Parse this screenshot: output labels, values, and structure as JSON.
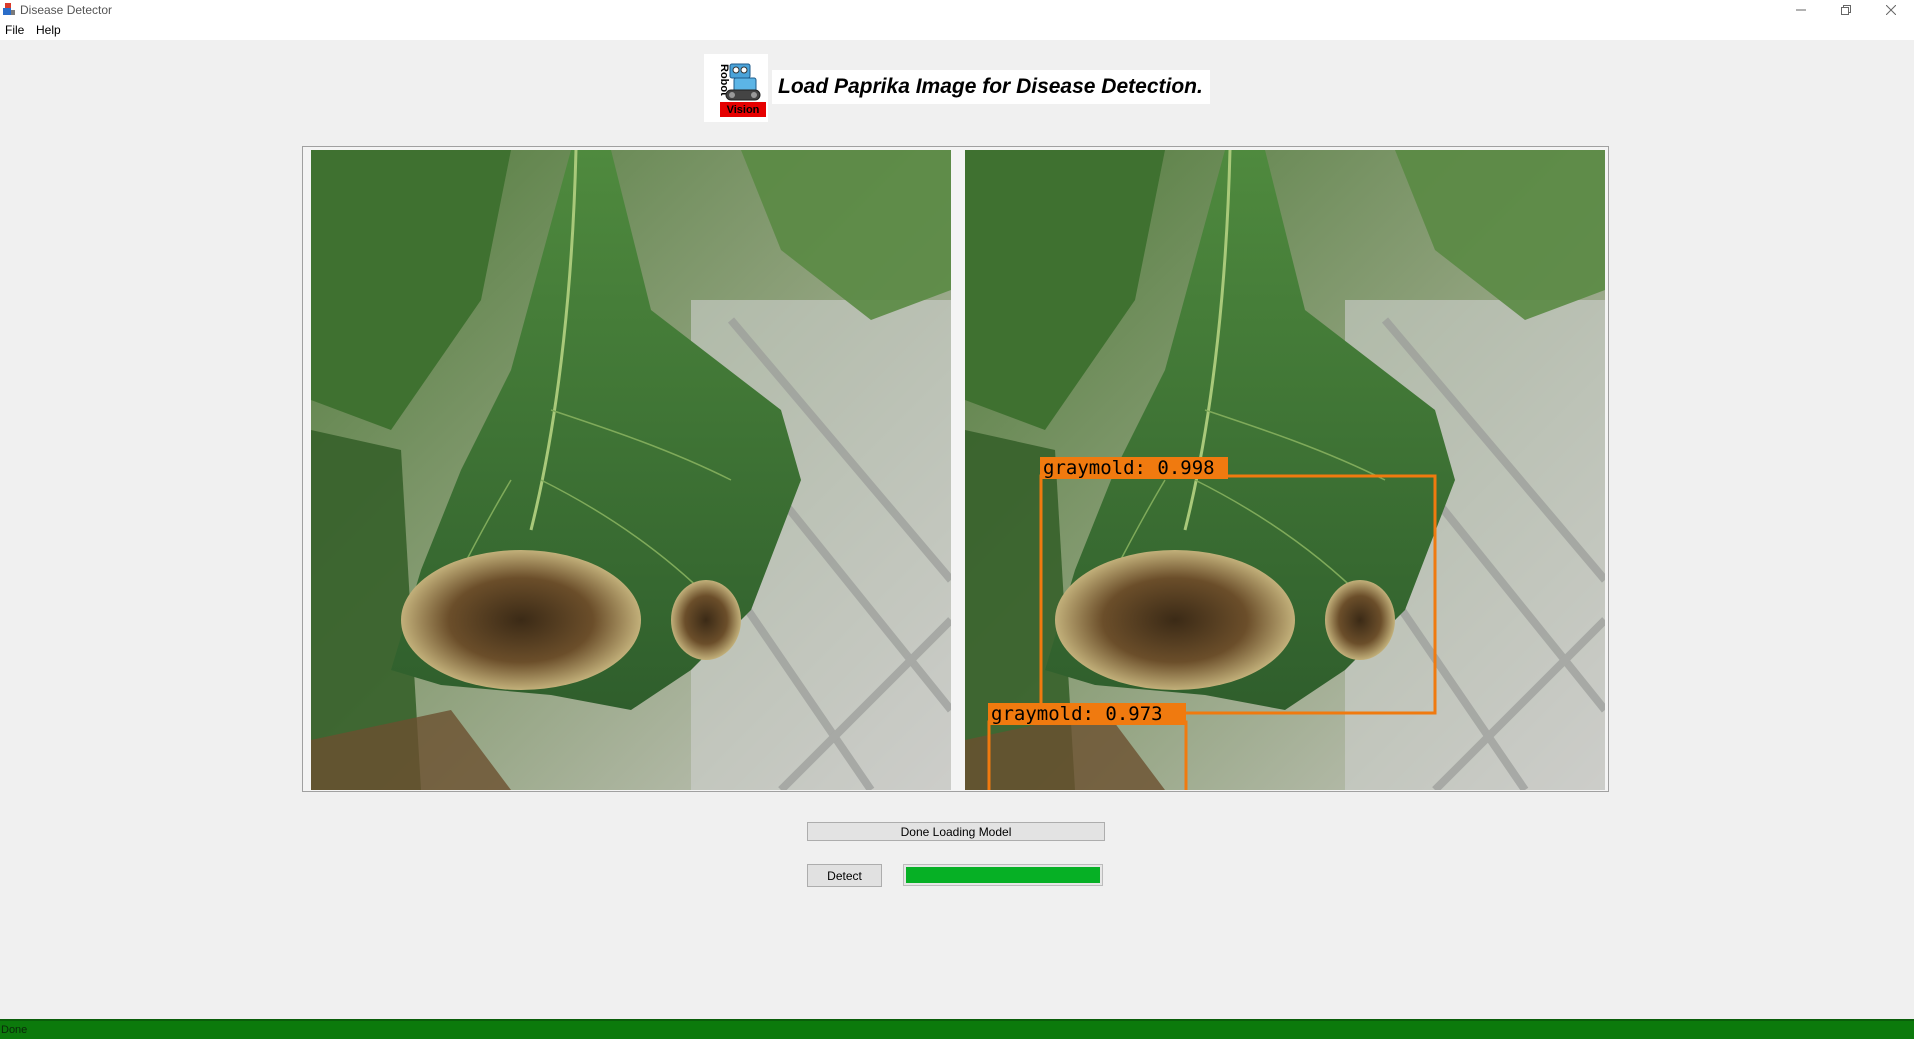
{
  "window": {
    "title": "Disease Detector"
  },
  "menu": {
    "items": [
      "File",
      "Help"
    ]
  },
  "banner": {
    "logo_text_top": "Robot",
    "logo_text_bottom": "Vision",
    "text": "Load Paprika Image for Disease Detection."
  },
  "detections": [
    {
      "label": "graymold: 0.998"
    },
    {
      "label": "graymold: 0.973"
    }
  ],
  "status_field": {
    "text": "Done Loading Model"
  },
  "detect_button": {
    "label": "Detect"
  },
  "progress": {
    "fraction": 1.0,
    "color": "#06b025"
  },
  "statusbar": {
    "text": "Done",
    "color": "#0c7a0c"
  },
  "colors": {
    "bbox": "#f07a0f"
  }
}
